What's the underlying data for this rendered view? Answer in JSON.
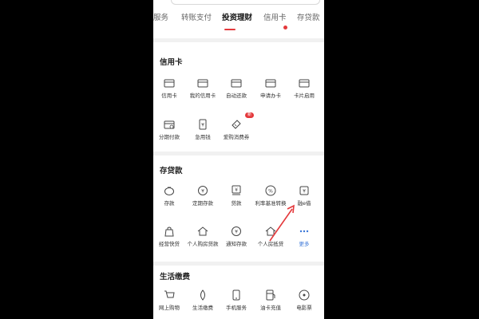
{
  "tabs": [
    {
      "label": "服务"
    },
    {
      "label": "转账支付"
    },
    {
      "label": "投资理财"
    },
    {
      "label": "信用卡"
    },
    {
      "label": "存贷款"
    }
  ],
  "active_tab": "投资理财",
  "accent_color": "#e4393c",
  "sections": {
    "credit_card": {
      "title": "信用卡",
      "items": [
        {
          "label": "信用卡",
          "icon": "card-icon"
        },
        {
          "label": "我的信用卡",
          "icon": "card-icon"
        },
        {
          "label": "自动还款",
          "icon": "card-icon"
        },
        {
          "label": "申请办卡",
          "icon": "card-icon"
        },
        {
          "label": "卡片启用",
          "icon": "card-icon"
        },
        {
          "label": "分期付款",
          "icon": "card-clock-icon"
        },
        {
          "label": "急用钱",
          "icon": "money-icon"
        },
        {
          "label": "爱购消费券",
          "icon": "ticket-icon",
          "badge": "新"
        }
      ]
    },
    "deposit_loan": {
      "title": "存贷款",
      "items": [
        {
          "label": "存款",
          "icon": "piggy-bank-icon"
        },
        {
          "label": "定期存款",
          "icon": "yuan-coin-icon"
        },
        {
          "label": "贷款",
          "icon": "loan-icon"
        },
        {
          "label": "利率基准转换",
          "icon": "percent-icon"
        },
        {
          "label": "融e借",
          "icon": "loan-app-icon"
        },
        {
          "label": "经营快贷",
          "icon": "bag-icon"
        },
        {
          "label": "个人购房贷款",
          "icon": "house-icon"
        },
        {
          "label": "通知存款",
          "icon": "yuan-coin-icon"
        },
        {
          "label": "个人房抵贷",
          "icon": "house-icon"
        },
        {
          "label": "更多",
          "icon": "more-dots-icon"
        }
      ]
    },
    "living": {
      "title": "生活缴费",
      "items": [
        {
          "label": "网上购物",
          "icon": "cart-icon"
        },
        {
          "label": "生活缴费",
          "icon": "drop-icon"
        },
        {
          "label": "手机服务",
          "icon": "phone-icon"
        },
        {
          "label": "油卡充值",
          "icon": "fuel-icon"
        },
        {
          "label": "电影票",
          "icon": "film-icon"
        }
      ]
    }
  }
}
